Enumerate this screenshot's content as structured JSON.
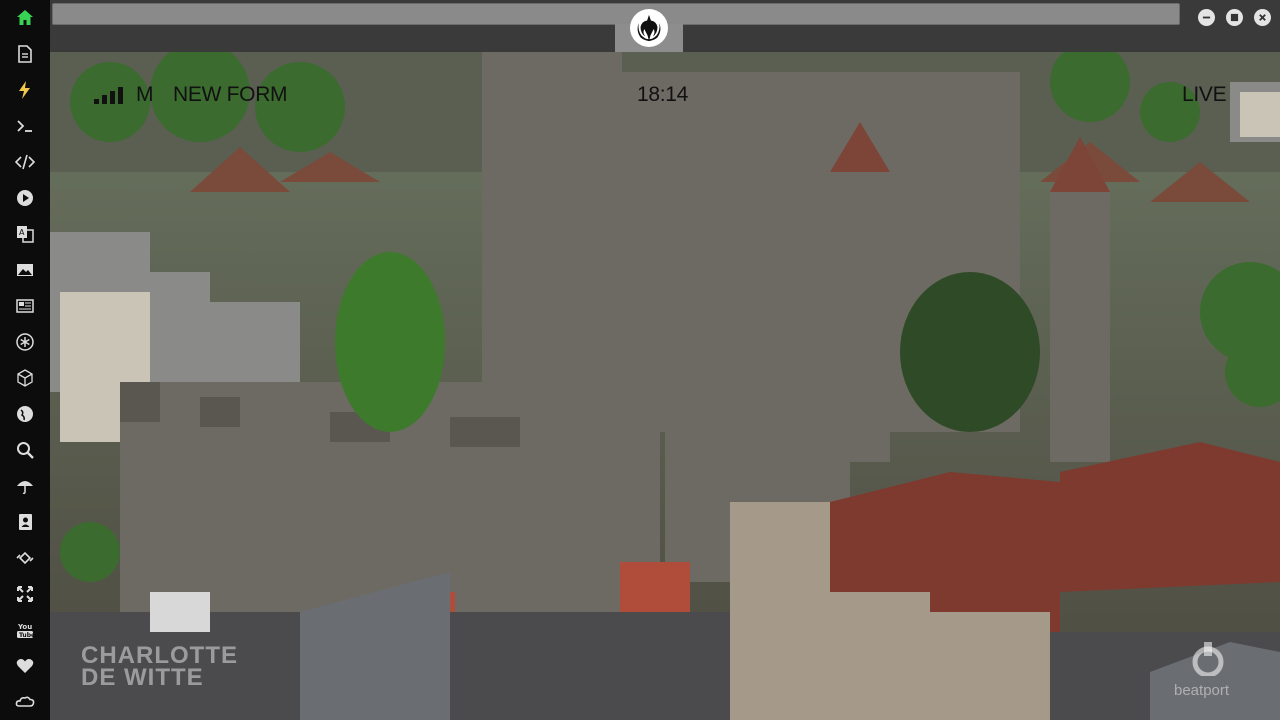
{
  "window": {
    "minimize_label": "–",
    "maximize_label": "▢",
    "close_label": "×"
  },
  "sidebar": {
    "items": [
      {
        "icon": "home-icon",
        "active": true
      },
      {
        "icon": "document-icon"
      },
      {
        "icon": "lightning-icon"
      },
      {
        "icon": "terminal-icon"
      },
      {
        "icon": "code-icon"
      },
      {
        "icon": "play-icon"
      },
      {
        "icon": "translate-icon"
      },
      {
        "icon": "image-icon"
      },
      {
        "icon": "news-icon"
      },
      {
        "icon": "asterisk-icon"
      },
      {
        "icon": "cube-icon"
      },
      {
        "icon": "globe-icon"
      },
      {
        "icon": "search-icon"
      },
      {
        "icon": "umbrella-icon"
      },
      {
        "icon": "contact-icon"
      },
      {
        "icon": "link-icon"
      },
      {
        "icon": "expand-icon"
      },
      {
        "icon": "youtube-icon"
      },
      {
        "icon": "heart-icon"
      },
      {
        "icon": "cloud-icon"
      }
    ],
    "accent_active": "#39d353",
    "accent_highlight": "#f2c94c"
  },
  "player": {
    "signal_label": "M",
    "show_title": "NEW FORM",
    "time": "18:14",
    "status": "LIVE",
    "watermark_artist_line1": "CHARLOTTE",
    "watermark_artist_line2": "DE WITTE",
    "watermark_brand": "beatport"
  }
}
